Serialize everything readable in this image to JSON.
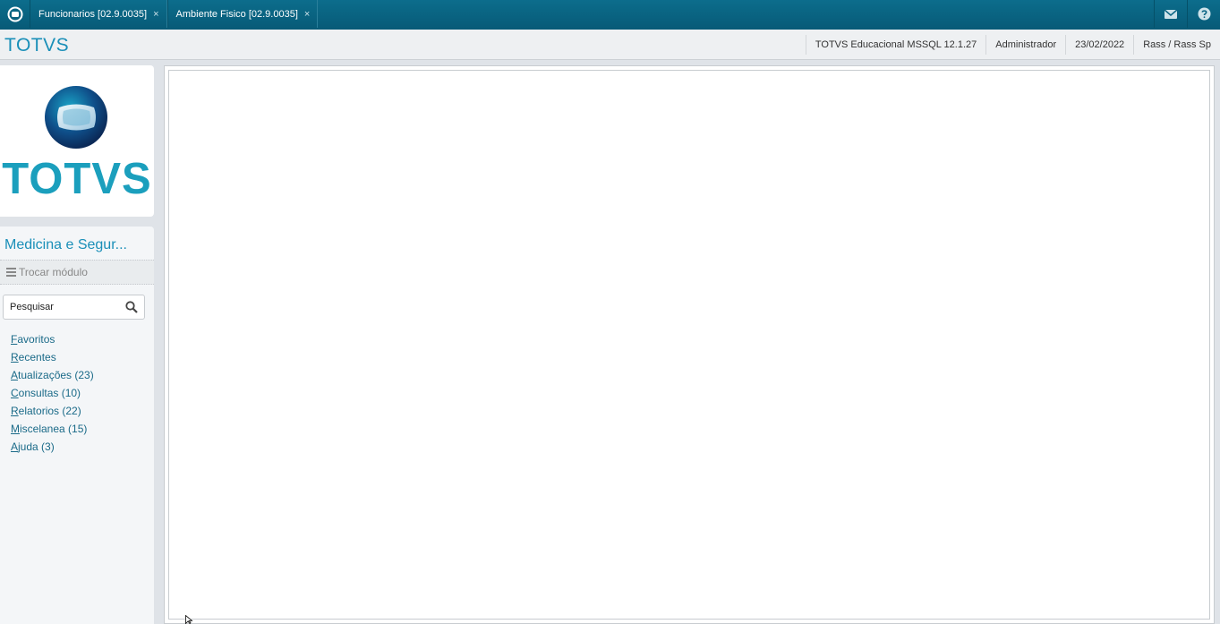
{
  "tabs": [
    {
      "label": "Funcionarios [02.9.0035]",
      "close": "×"
    },
    {
      "label": "Ambiente Fisico [02.9.0035]",
      "close": "×"
    }
  ],
  "top_icons": [
    "mail-icon",
    "help-icon"
  ],
  "header": {
    "brand": "TOTVS",
    "info": [
      "TOTVS Educacional MSSQL 12.1.27",
      "Administrador",
      "23/02/2022",
      "Rass / Rass Sp"
    ]
  },
  "sidebar": {
    "logo_text": "TOTVS",
    "module_title": "Medicina e Segur...",
    "switch_module_label": "Trocar módulo",
    "search": {
      "value": "",
      "placeholder": "Pesquisar"
    },
    "menu": [
      {
        "first": "F",
        "rest": "avoritos"
      },
      {
        "first": "R",
        "rest": "ecentes"
      },
      {
        "first": "A",
        "rest": "tualizações (23)"
      },
      {
        "first": "C",
        "rest": "onsultas (10)"
      },
      {
        "first": "R",
        "rest": "elatorios (22)"
      },
      {
        "first": "M",
        "rest": "iscelanea (15)"
      },
      {
        "first": "A",
        "rest": "juda (3)"
      }
    ]
  },
  "colors": {
    "topbar": "#0c6d8c",
    "brand": "#1a8fb8",
    "menu_link": "#1a6a88"
  }
}
